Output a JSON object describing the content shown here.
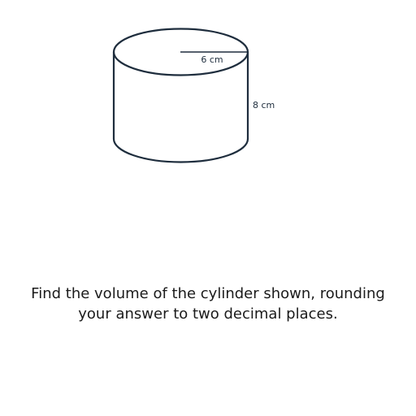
{
  "diagram": {
    "shape": "cylinder",
    "radius_label": "6 cm",
    "height_label": "8 cm",
    "stroke_color": "#1e2d3d"
  },
  "question": {
    "text": "Find the volume of the cylinder shown, rounding your answer to two decimal places."
  }
}
